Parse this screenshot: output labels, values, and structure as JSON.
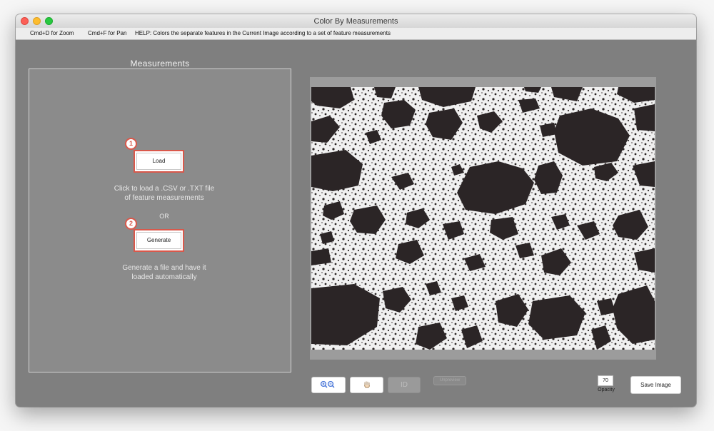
{
  "window": {
    "title": "Color By Measurements"
  },
  "menubar": {
    "zoom_hint": "Cmd+D for Zoom",
    "pan_hint": "Cmd+F for Pan",
    "help_text": "HELP:  Colors the separate features in the Current Image according to a set of feature measurements"
  },
  "measurements": {
    "title": "Measurements",
    "step1": "1",
    "load_label": "Load",
    "load_caption_line1": "Click to load a .CSV or .TXT file",
    "load_caption_line2": "of feature measurements",
    "or_label": "OR",
    "step2": "2",
    "generate_label": "Generate",
    "generate_caption_line1": "Generate a file and have it",
    "generate_caption_line2": "loaded automatically"
  },
  "toolbar": {
    "zoom_icon": "zoom-in-out-icon",
    "pan_icon": "hand-icon",
    "id_label": "ID",
    "unpreview_label": "Unpreview",
    "opacity_value": "70",
    "opacity_label": "Opacity",
    "save_label": "Save Image"
  },
  "colors": {
    "accent_red": "#d9584b",
    "window_bg": "#7f7f7f"
  }
}
